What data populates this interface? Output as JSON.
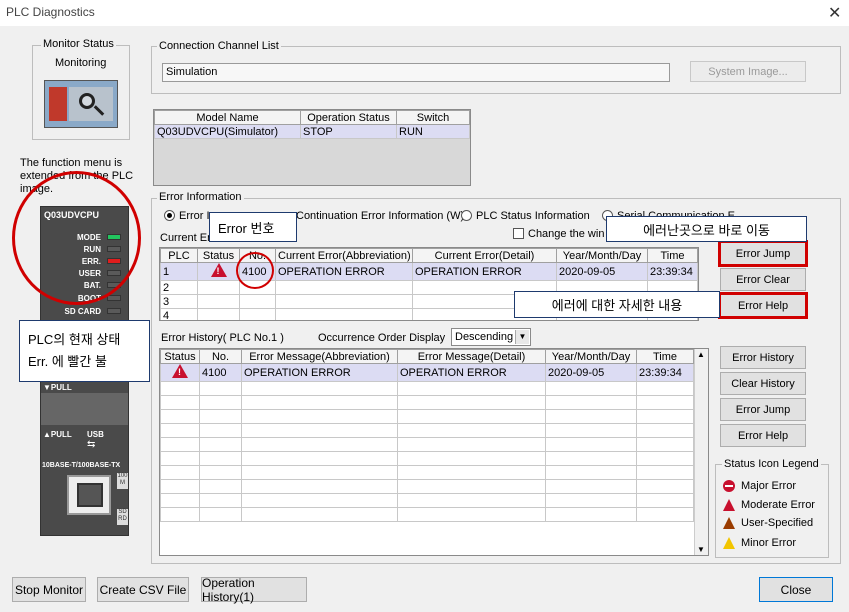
{
  "window": {
    "title": "PLC Diagnostics",
    "close": "✕"
  },
  "monitor": {
    "group": "Monitor Status",
    "status": "Monitoring"
  },
  "note": "The function menu is extended from the PLC image.",
  "plc": {
    "model_label": "Q03UDVCPU",
    "leds": [
      "MODE",
      "RUN",
      "ERR.",
      "USER",
      "BAT.",
      "BOOT",
      "SD CARD"
    ],
    "pull1": "▼PULL",
    "pull2": "▲PULL",
    "usb": "USB",
    "ethernet": "10BASE-T/100BASE-TX",
    "side1": "100 M",
    "side2": "SD RD"
  },
  "callouts": {
    "plc_state_line1": "PLC의 현재 상태",
    "plc_state_line2": "Err. 에 빨간 불",
    "error_no": "Error 번호",
    "error_jump": "에러난곳으로 바로 이동",
    "error_help": "에러에 대한 자세한 내용"
  },
  "connection": {
    "group": "Connection Channel List",
    "value": "Simulation",
    "system_image": "System Image..."
  },
  "model_table": {
    "headers": [
      "Model Name",
      "Operation Status",
      "Switch"
    ],
    "row": [
      "Q03UDVCPU(Simulator)",
      "STOP",
      "RUN"
    ]
  },
  "error_info": {
    "group": "Error Information",
    "radio1": "Error I",
    "radio2": "Continuation Error Information (W)",
    "radio3": "PLC Status Information",
    "radio4": "Serial Communication E",
    "current_label": "Current Err",
    "change_window": "Change the win",
    "headers": [
      "PLC",
      "Status",
      "No.",
      "Current Error(Abbreviation)",
      "Current Error(Detail)",
      "Year/Month/Day",
      "Time"
    ],
    "rows": [
      [
        "1",
        "!",
        "4100",
        "OPERATION ERROR",
        "OPERATION ERROR",
        "2020-09-05",
        "23:39:34"
      ],
      [
        "2",
        "",
        "",
        "",
        "",
        "",
        ""
      ],
      [
        "3",
        "",
        "",
        "",
        "",
        "",
        ""
      ],
      [
        "4",
        "",
        "",
        "",
        "",
        "",
        ""
      ]
    ],
    "btn_jump": "Error Jump",
    "btn_clear": "Error Clear",
    "btn_help": "Error Help"
  },
  "history": {
    "label": "Error History( PLC No.1 )",
    "order_label": "Occurrence Order Display",
    "order_value": "Descending",
    "headers": [
      "Status",
      "No.",
      "Error Message(Abbreviation)",
      "Error Message(Detail)",
      "Year/Month/Day",
      "Time"
    ],
    "rows": [
      [
        "!",
        "4100",
        "OPERATION ERROR",
        "OPERATION ERROR",
        "2020-09-05",
        "23:39:34"
      ]
    ],
    "btn_history": "Error History",
    "btn_clear": "Clear History",
    "btn_jump": "Error Jump",
    "btn_help": "Error Help"
  },
  "legend": {
    "group": "Status Icon Legend",
    "items": [
      "Major Error",
      "Moderate Error",
      "User-Specified",
      "Minor Error"
    ]
  },
  "footer": {
    "stop_monitor": "Stop Monitor",
    "csv": "Create CSV File",
    "op_history": "Operation History(1)",
    "close": "Close"
  },
  "colors": {
    "highlight_red": "#d00000",
    "row_select": "#dcdcf3",
    "led_green": "#22c55e",
    "led_red": "#e11d1d"
  }
}
